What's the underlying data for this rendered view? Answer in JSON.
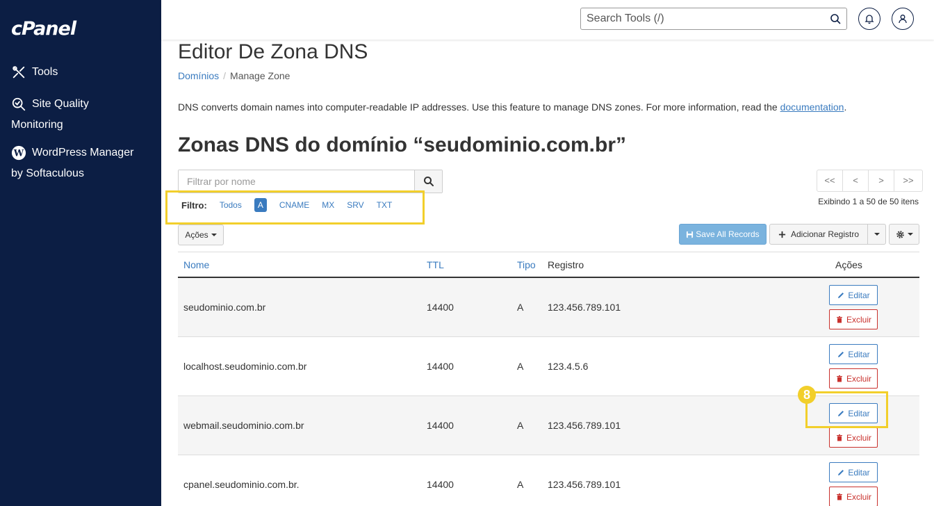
{
  "sidebar": {
    "logo": "cPanel",
    "items": [
      {
        "label_line1": "Tools",
        "label_line2": ""
      },
      {
        "label_line1": "Site Quality",
        "label_line2": "Monitoring"
      },
      {
        "label_line1": "WordPress Manager",
        "label_line2": "by Softaculous"
      }
    ]
  },
  "header": {
    "search_placeholder": "Search Tools (/)"
  },
  "main": {
    "title": "Editor De Zona DNS",
    "breadcrumb": {
      "link": "Domínios",
      "separator": "/",
      "current": "Manage Zone"
    },
    "description": "DNS converts domain names into computer-readable IP addresses. Use this feature to manage DNS zones. For more information, read the ",
    "doc_link": "documentation",
    "desc_end": ".",
    "section_title": "Zonas DNS do domínio “seudominio.com.br”",
    "filter_placeholder": "Filtrar por nome",
    "filter_label": "Filtro:",
    "filter_options": [
      "Todos",
      "A",
      "CNAME",
      "MX",
      "SRV",
      "TXT"
    ],
    "filter_active": "A",
    "pager": [
      "<<",
      "<",
      ">",
      ">>"
    ],
    "showing": "Exibindo 1 a 50 de 50 itens",
    "actions_btn": "Ações",
    "save_all": "Save All Records",
    "add_record": "Adicionar Registro"
  },
  "table": {
    "headers": {
      "name": "Nome",
      "ttl": "TTL",
      "type": "Tipo",
      "record": "Registro",
      "actions": "Ações"
    },
    "edit_label": "Editar",
    "delete_label": "Excluir",
    "rows": [
      {
        "name": "seudominio.com.br",
        "ttl": "14400",
        "type": "A",
        "record": "123.456.789.101"
      },
      {
        "name": "localhost.seudominio.com.br",
        "ttl": "14400",
        "type": "A",
        "record": "123.4.5.6"
      },
      {
        "name": "webmail.seudominio.com.br",
        "ttl": "14400",
        "type": "A",
        "record": "123.456.789.101"
      },
      {
        "name": "cpanel.seudominio.com.br.",
        "ttl": "14400",
        "type": "A",
        "record": "123.456.789.101"
      }
    ]
  },
  "annotation": {
    "step_number": "8",
    "color": "#f2cf2b"
  }
}
